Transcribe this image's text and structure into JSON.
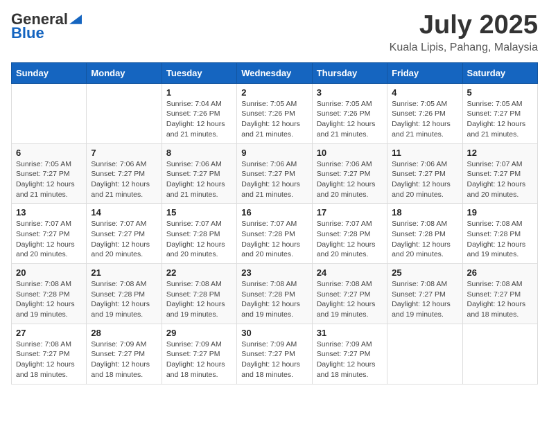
{
  "logo": {
    "general": "General",
    "blue": "Blue"
  },
  "header": {
    "month_title": "July 2025",
    "subtitle": "Kuala Lipis, Pahang, Malaysia"
  },
  "weekdays": [
    "Sunday",
    "Monday",
    "Tuesday",
    "Wednesday",
    "Thursday",
    "Friday",
    "Saturday"
  ],
  "weeks": [
    [
      {
        "day": "",
        "info": ""
      },
      {
        "day": "",
        "info": ""
      },
      {
        "day": "1",
        "info": "Sunrise: 7:04 AM\nSunset: 7:26 PM\nDaylight: 12 hours and 21 minutes."
      },
      {
        "day": "2",
        "info": "Sunrise: 7:05 AM\nSunset: 7:26 PM\nDaylight: 12 hours and 21 minutes."
      },
      {
        "day": "3",
        "info": "Sunrise: 7:05 AM\nSunset: 7:26 PM\nDaylight: 12 hours and 21 minutes."
      },
      {
        "day": "4",
        "info": "Sunrise: 7:05 AM\nSunset: 7:26 PM\nDaylight: 12 hours and 21 minutes."
      },
      {
        "day": "5",
        "info": "Sunrise: 7:05 AM\nSunset: 7:27 PM\nDaylight: 12 hours and 21 minutes."
      }
    ],
    [
      {
        "day": "6",
        "info": "Sunrise: 7:05 AM\nSunset: 7:27 PM\nDaylight: 12 hours and 21 minutes."
      },
      {
        "day": "7",
        "info": "Sunrise: 7:06 AM\nSunset: 7:27 PM\nDaylight: 12 hours and 21 minutes."
      },
      {
        "day": "8",
        "info": "Sunrise: 7:06 AM\nSunset: 7:27 PM\nDaylight: 12 hours and 21 minutes."
      },
      {
        "day": "9",
        "info": "Sunrise: 7:06 AM\nSunset: 7:27 PM\nDaylight: 12 hours and 21 minutes."
      },
      {
        "day": "10",
        "info": "Sunrise: 7:06 AM\nSunset: 7:27 PM\nDaylight: 12 hours and 20 minutes."
      },
      {
        "day": "11",
        "info": "Sunrise: 7:06 AM\nSunset: 7:27 PM\nDaylight: 12 hours and 20 minutes."
      },
      {
        "day": "12",
        "info": "Sunrise: 7:07 AM\nSunset: 7:27 PM\nDaylight: 12 hours and 20 minutes."
      }
    ],
    [
      {
        "day": "13",
        "info": "Sunrise: 7:07 AM\nSunset: 7:27 PM\nDaylight: 12 hours and 20 minutes."
      },
      {
        "day": "14",
        "info": "Sunrise: 7:07 AM\nSunset: 7:27 PM\nDaylight: 12 hours and 20 minutes."
      },
      {
        "day": "15",
        "info": "Sunrise: 7:07 AM\nSunset: 7:28 PM\nDaylight: 12 hours and 20 minutes."
      },
      {
        "day": "16",
        "info": "Sunrise: 7:07 AM\nSunset: 7:28 PM\nDaylight: 12 hours and 20 minutes."
      },
      {
        "day": "17",
        "info": "Sunrise: 7:07 AM\nSunset: 7:28 PM\nDaylight: 12 hours and 20 minutes."
      },
      {
        "day": "18",
        "info": "Sunrise: 7:08 AM\nSunset: 7:28 PM\nDaylight: 12 hours and 20 minutes."
      },
      {
        "day": "19",
        "info": "Sunrise: 7:08 AM\nSunset: 7:28 PM\nDaylight: 12 hours and 19 minutes."
      }
    ],
    [
      {
        "day": "20",
        "info": "Sunrise: 7:08 AM\nSunset: 7:28 PM\nDaylight: 12 hours and 19 minutes."
      },
      {
        "day": "21",
        "info": "Sunrise: 7:08 AM\nSunset: 7:28 PM\nDaylight: 12 hours and 19 minutes."
      },
      {
        "day": "22",
        "info": "Sunrise: 7:08 AM\nSunset: 7:28 PM\nDaylight: 12 hours and 19 minutes."
      },
      {
        "day": "23",
        "info": "Sunrise: 7:08 AM\nSunset: 7:28 PM\nDaylight: 12 hours and 19 minutes."
      },
      {
        "day": "24",
        "info": "Sunrise: 7:08 AM\nSunset: 7:27 PM\nDaylight: 12 hours and 19 minutes."
      },
      {
        "day": "25",
        "info": "Sunrise: 7:08 AM\nSunset: 7:27 PM\nDaylight: 12 hours and 19 minutes."
      },
      {
        "day": "26",
        "info": "Sunrise: 7:08 AM\nSunset: 7:27 PM\nDaylight: 12 hours and 18 minutes."
      }
    ],
    [
      {
        "day": "27",
        "info": "Sunrise: 7:08 AM\nSunset: 7:27 PM\nDaylight: 12 hours and 18 minutes."
      },
      {
        "day": "28",
        "info": "Sunrise: 7:09 AM\nSunset: 7:27 PM\nDaylight: 12 hours and 18 minutes."
      },
      {
        "day": "29",
        "info": "Sunrise: 7:09 AM\nSunset: 7:27 PM\nDaylight: 12 hours and 18 minutes."
      },
      {
        "day": "30",
        "info": "Sunrise: 7:09 AM\nSunset: 7:27 PM\nDaylight: 12 hours and 18 minutes."
      },
      {
        "day": "31",
        "info": "Sunrise: 7:09 AM\nSunset: 7:27 PM\nDaylight: 12 hours and 18 minutes."
      },
      {
        "day": "",
        "info": ""
      },
      {
        "day": "",
        "info": ""
      }
    ]
  ]
}
